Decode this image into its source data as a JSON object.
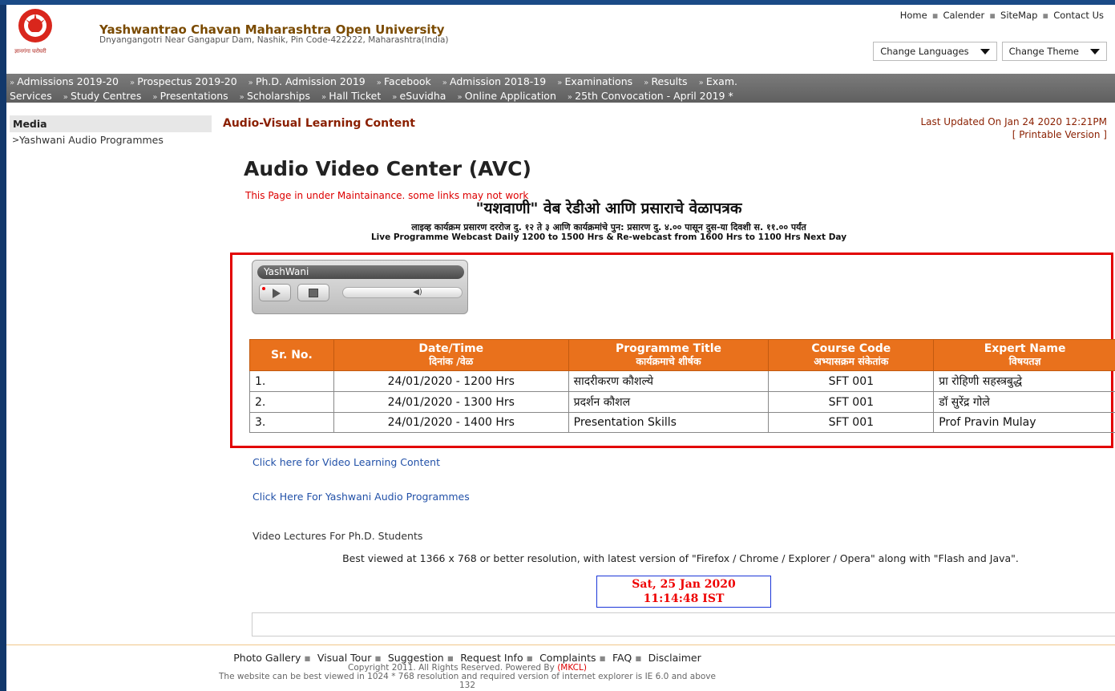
{
  "header": {
    "logo_caption": "ज्ञानगंगा घरोघरी",
    "university_name": "Yashwantrao Chavan Maharashtra Open University",
    "address": "Dnyangangotri Near Gangapur Dam, Nashik, Pin Code-422222, Maharashtra(India)",
    "top_links": [
      "Home",
      "Calender",
      "SiteMap",
      "Contact Us"
    ],
    "change_languages": "Change Languages",
    "change_theme": "Change Theme"
  },
  "nav": {
    "items": [
      "Admissions 2019-20",
      "Prospectus 2019-20",
      "Ph.D. Admission 2019",
      "Facebook",
      "Admission 2018-19",
      "Examinations",
      "Results",
      "Exam.",
      "Services",
      "Study Centres",
      "Presentations",
      "Scholarships",
      "Hall Ticket",
      "eSuvidha",
      "Online Application",
      "25th Convocation - April 2019 *"
    ]
  },
  "sidebar": {
    "heading": "Media",
    "items": [
      "Yashwani Audio Programmes"
    ]
  },
  "content": {
    "section_title": "Audio-Visual Learning Content",
    "last_updated": "Last Updated On Jan 24 2020 12:21PM",
    "printable": "[ Printable Version ]",
    "page_title": "Audio Video Center (AVC)",
    "maintenance": "This Page in under Maintainance. some links may not work",
    "marathi_title": "\"यशवाणी\" वेब रेडीओ आणि प्रसाराचे वेळापत्रक",
    "marathi_sub": "लाइव्ह कार्यक्रम प्रसारण दररोज दु. १२ ते ३ आणि कार्यक्रमांचे पुन: प्रसारण दु. ४.०० पासून दुस-या दिवशी स. ११.०० पर्यंत",
    "english_sub": "Live Programme Webcast Daily 1200 to 1500 Hrs & Re-webcast from 1600 Hrs to 1100 Hrs Next Day"
  },
  "player": {
    "title": "YashWani"
  },
  "table": {
    "headers": [
      {
        "en": "Sr. No.",
        "mr": ""
      },
      {
        "en": "Date/Time",
        "mr": "दिनांक /वेळ"
      },
      {
        "en": "Programme Title",
        "mr": "कार्यक्रमाचे शीर्षक"
      },
      {
        "en": "Course Code",
        "mr": "अभ्यासक्रम संकेतांक"
      },
      {
        "en": "Expert Name",
        "mr": "विषयतज्ञ"
      }
    ],
    "rows": [
      [
        "1.",
        "24/01/2020 - 1200 Hrs",
        "सादरीकरण कौशल्ये",
        "SFT 001",
        "प्रा रोहिणी सहस्त्रबुद्धे"
      ],
      [
        "2.",
        "24/01/2020 - 1300 Hrs",
        "प्रदर्शन कौशल",
        "SFT 001",
        "डॉ सुरेंद्र गोले"
      ],
      [
        "3.",
        "24/01/2020 - 1400 Hrs",
        "Presentation Skills",
        "SFT 001",
        "Prof Pravin Mulay"
      ]
    ]
  },
  "links": {
    "video": "Click here for Video Learning Content",
    "audio": "Click Here For Yashwani Audio Programmes",
    "phd": "Video Lectures For Ph.D. Students"
  },
  "best_viewed": "Best viewed at 1366 x 768 or better resolution, with latest version of \"Firefox / Chrome / Explorer / Opera\" along with \"Flash and Java\".",
  "clock": {
    "date": "Sat, 25 Jan 2020",
    "time": "11:14:48 IST"
  },
  "footer": {
    "links": [
      "Photo Gallery",
      "Visual Tour",
      "Suggestion",
      "Request Info",
      "Complaints",
      "FAQ",
      "Disclaimer"
    ],
    "copyright": "Copyright 2011. All Rights Reserved. Powered By",
    "powered_by": "(MKCL)",
    "note": "The website can be best viewed in 1024 * 768 resolution and required version of internet explorer is IE 6.0 and above",
    "counter": "132"
  },
  "colors": {
    "table_header": "#e9711c",
    "highlight_box": "#e20000",
    "title_brown": "#8a1f00"
  }
}
